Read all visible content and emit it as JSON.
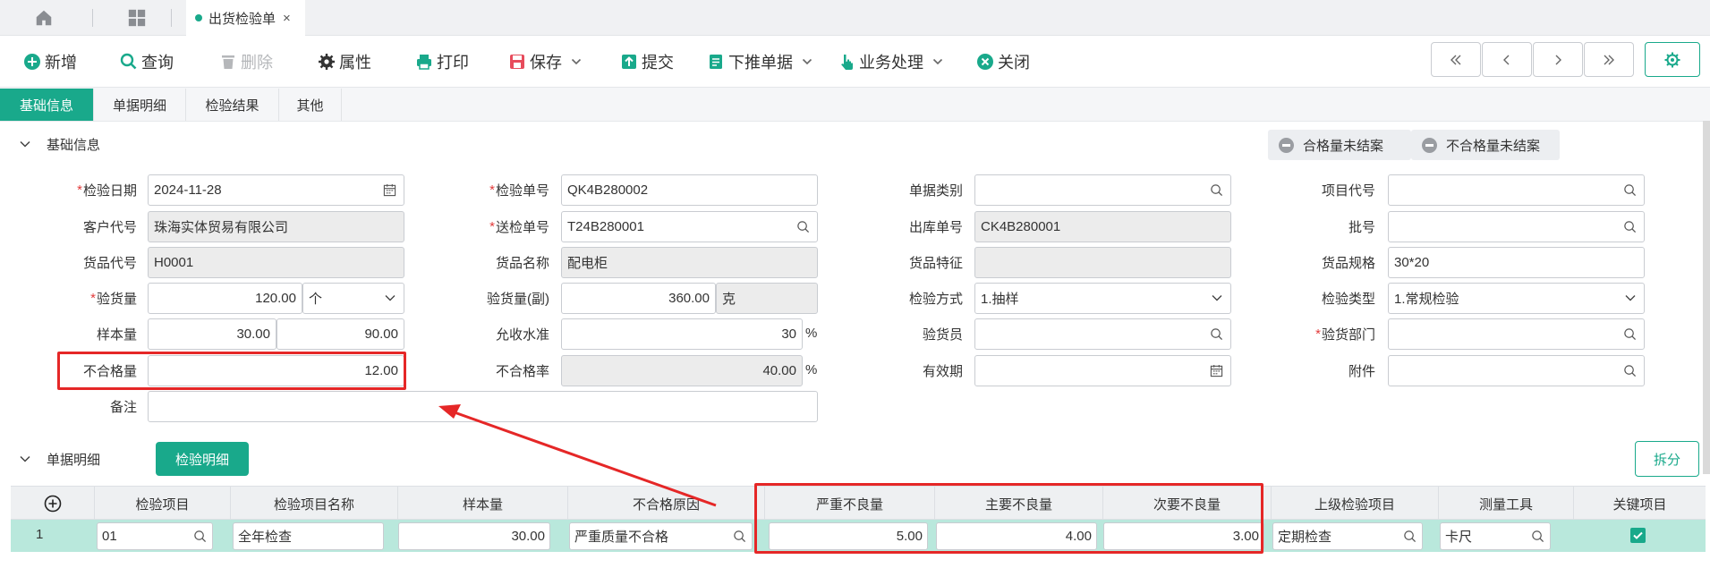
{
  "tabs": {
    "doc_tab": "出货检验单",
    "close": "×"
  },
  "toolbar": {
    "new": "新增",
    "query": "查询",
    "delete": "删除",
    "props": "属性",
    "print": "打印",
    "save": "保存",
    "submit": "提交",
    "push": "下推单据",
    "biz": "业务处理",
    "close": "关闭"
  },
  "subtabs": [
    "基础信息",
    "单据明细",
    "检验结果",
    "其他"
  ],
  "section1": {
    "title": "基础信息",
    "tag_pass": "合格量未结案",
    "tag_fail": "不合格量未结案"
  },
  "form": {
    "inspect_date_label": "检验日期",
    "inspect_date": "2024-11-28",
    "inspect_no_label": "检验单号",
    "inspect_no": "QK4B280002",
    "doc_type_label": "单据类别",
    "doc_type": "",
    "project_code_label": "项目代号",
    "project_code": "",
    "customer_label": "客户代号",
    "customer": "珠海实体贸易有限公司",
    "send_no_label": "送检单号",
    "send_no": "T24B280001",
    "outbound_label": "出库单号",
    "outbound": "CK4B280001",
    "batch_label": "批号",
    "batch": "",
    "goods_code_label": "货品代号",
    "goods_code": "H0001",
    "goods_name_label": "货品名称",
    "goods_name": "配电柜",
    "goods_feature_label": "货品特征",
    "goods_feature": "",
    "goods_spec_label": "货品规格",
    "goods_spec": "30*20",
    "qty_label": "验货量",
    "qty": "120.00",
    "qty_unit": "个",
    "qty2_label": "验货量(副)",
    "qty2": "360.00",
    "qty2_unit": "克",
    "method_label": "检验方式",
    "method": "1.抽样",
    "type_label": "检验类型",
    "type": "1.常规检验",
    "sample_label": "样本量",
    "sample1": "30.00",
    "sample2": "90.00",
    "accept_label": "允收水准",
    "accept": "30",
    "pct": "%",
    "inspector_label": "验货员",
    "inspector": "",
    "dept_label": "验货部门",
    "dept": "",
    "defect_label": "不合格量",
    "defect": "12.00",
    "defect_rate_label": "不合格率",
    "defect_rate": "40.00",
    "valid_label": "有效期",
    "valid": "",
    "attach_label": "附件",
    "attach": "",
    "remark_label": "备注",
    "remark": ""
  },
  "section2": {
    "title": "单据明细",
    "detail_btn": "检验明细",
    "split_btn": "拆分"
  },
  "grid": {
    "headers": [
      "检验项目",
      "检验项目名称",
      "样本量",
      "不合格原因",
      "严重不良量",
      "主要不良量",
      "次要不良量",
      "上级检验项目",
      "测量工具",
      "关键项目"
    ],
    "row": {
      "no": "1",
      "item": "01",
      "name": "全年检查",
      "sample": "30.00",
      "reason": "严重质量不合格",
      "critical": "5.00",
      "major": "4.00",
      "minor": "3.00",
      "parent": "定期检查",
      "tool": "卡尺",
      "key": true
    }
  },
  "colors": {
    "accent": "#19a98b",
    "highlight": "#e52727",
    "row": "#b9e8dc"
  }
}
